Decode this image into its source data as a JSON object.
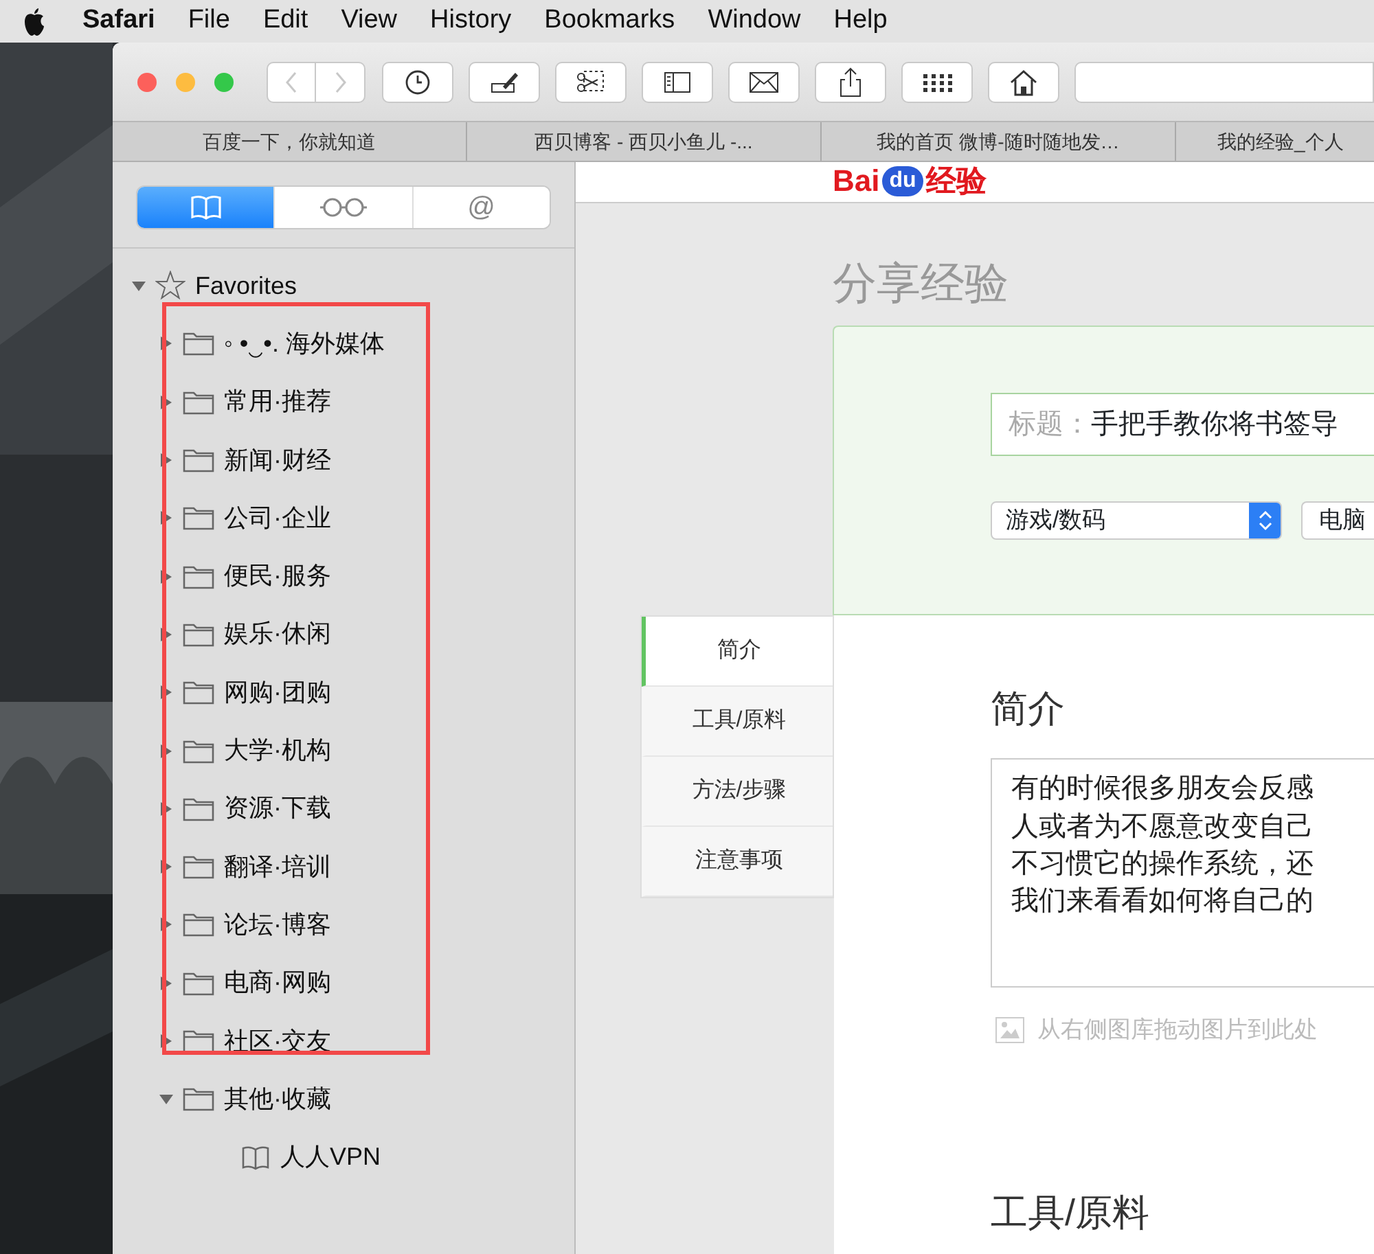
{
  "menu_bar": {
    "app": "Safari",
    "items": [
      "File",
      "Edit",
      "View",
      "History",
      "Bookmarks",
      "Window",
      "Help"
    ]
  },
  "navigation": [
    {
      "kind": "back",
      "disabled": true
    },
    {
      "kind": "forward",
      "disabled": true
    }
  ],
  "tabs": [
    {
      "label": "百度一下，你就知道",
      "selected": false
    },
    {
      "label": "西贝博客 - 西贝小鱼儿 -...",
      "selected": false
    },
    {
      "label": "我的首页 微博-随时随地发…",
      "selected": false
    },
    {
      "label": "我的经验_个人",
      "selected": false
    }
  ],
  "sidebar": {
    "segments": [
      {
        "kind": "bookmarks",
        "selected": true
      },
      {
        "kind": "reading_list",
        "selected": false
      },
      {
        "kind": "shared_links",
        "label": "@",
        "selected": false
      }
    ],
    "tree": [
      {
        "kind": "favorites",
        "label": "Favorites",
        "expanded": true,
        "children": [
          {
            "kind": "folder",
            "label": "◦ •‿•. 海外媒体",
            "expanded": false
          },
          {
            "kind": "folder",
            "label": "常用·推荐",
            "expanded": false
          },
          {
            "kind": "folder",
            "label": "新闻·财经",
            "expanded": false
          },
          {
            "kind": "folder",
            "label": "公司·企业",
            "expanded": false
          },
          {
            "kind": "folder",
            "label": "便民·服务",
            "expanded": false
          },
          {
            "kind": "folder",
            "label": "娱乐·休闲",
            "expanded": false
          },
          {
            "kind": "folder",
            "label": "网购·团购",
            "expanded": false
          },
          {
            "kind": "folder",
            "label": "大学·机构",
            "expanded": false
          },
          {
            "kind": "folder",
            "label": "资源·下载",
            "expanded": false
          },
          {
            "kind": "folder",
            "label": "翻译·培训",
            "expanded": false
          },
          {
            "kind": "folder",
            "label": "论坛·博客",
            "expanded": false
          },
          {
            "kind": "folder",
            "label": "电商·网购",
            "expanded": false
          },
          {
            "kind": "folder",
            "label": "社区·交友",
            "expanded": false
          },
          {
            "kind": "folder",
            "label": "其他·收藏",
            "expanded": true,
            "children": [
              {
                "kind": "bookmark",
                "label": "人人VPN"
              }
            ]
          }
        ]
      }
    ]
  },
  "annotation": {
    "kind": "highlight_frame"
  },
  "page": {
    "logo": [
      "Bai",
      "du",
      "经验"
    ],
    "title": "分享经验",
    "form": {
      "title_label": "标题：",
      "title_value": "手把手教你将书签导",
      "category": "游戏/数码",
      "subcategory": "电脑"
    },
    "side_tabs": [
      {
        "label": "简介",
        "selected": true
      },
      {
        "label": "工具/原料",
        "selected": false
      },
      {
        "label": "方法/步骤",
        "selected": false
      },
      {
        "label": "注意事项",
        "selected": false
      }
    ],
    "section_heading": "简介",
    "intro_lines": [
      "有的时候很多朋友会反感",
      "人或者为不愿意改变自己",
      "不习惯它的操作系统，还",
      "我们来看看如何将自己的"
    ],
    "image_hint": "从右侧图库拖动图片到此处",
    "next_heading": "工具/原料"
  }
}
